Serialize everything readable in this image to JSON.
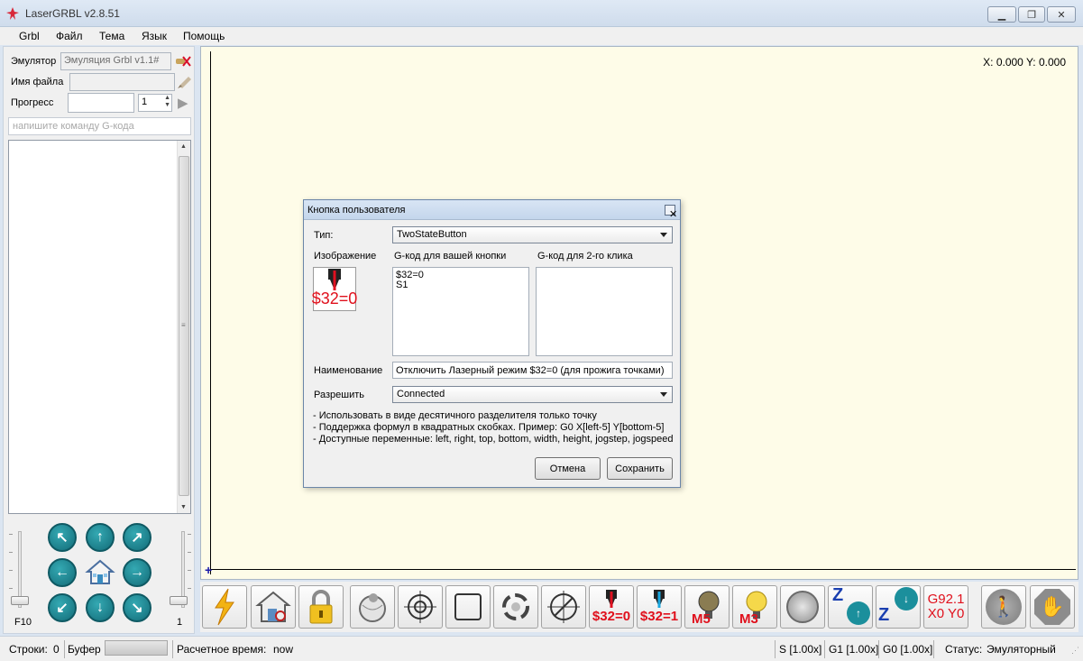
{
  "window": {
    "title": "LaserGRBL v2.8.51"
  },
  "menu": [
    "Grbl",
    "Файл",
    "Тема",
    "Язык",
    "Помощь"
  ],
  "left": {
    "emulator_label": "Эмулятор",
    "emulator_value": "Эмуляция Grbl v1.1#",
    "filename_label": "Имя файла",
    "progress_label": "Прогресс",
    "progress_count": "1",
    "command_placeholder": "напишите команду G-кода",
    "speed_label": "F10",
    "step_label": "1",
    "home_icon": "house-icon"
  },
  "canvas": {
    "coords": "X: 0.000 Y: 0.000"
  },
  "toolbar": {
    "buttons": [
      {
        "icon": "lightning-icon"
      },
      {
        "icon": "home-search-icon"
      },
      {
        "icon": "padlock-icon"
      },
      {
        "icon": "globe-pin-icon"
      },
      {
        "icon": "crosshair-icon"
      },
      {
        "icon": "frame-icon"
      },
      {
        "icon": "rotate-icon"
      },
      {
        "icon": "crosshair-arrows-icon"
      },
      {
        "icon": "laser-mode-off-icon",
        "text": "$32=0"
      },
      {
        "icon": "laser-mode-on-icon",
        "text": "$32=1"
      },
      {
        "icon": "bulb-off-icon",
        "text": "M5"
      },
      {
        "icon": "bulb-on-icon",
        "text": "M3"
      },
      {
        "icon": "diagonal-arrows-icon"
      },
      {
        "icon": "z-up-icon",
        "text": "Z"
      },
      {
        "icon": "z-down-icon",
        "text": "Z"
      },
      {
        "icon": "g92-icon",
        "text": "G92.1\nX0 Y0"
      },
      {
        "icon": "walk-icon"
      },
      {
        "icon": "stop-hand-icon"
      }
    ]
  },
  "status": {
    "lines_label": "Строки:",
    "lines_value": "0",
    "buffer_label": "Буфер",
    "est_label": "Расчетное время:",
    "est_value": "now",
    "s_override": "S [1.00x]",
    "g1_override": "G1 [1.00x]",
    "g0_override": "G0 [1.00x]",
    "state_label": "Статус:",
    "state_value": "Эмуляторный"
  },
  "dialog": {
    "title": "Кнопка пользователя",
    "type_label": "Тип:",
    "type_value": "TwoStateButton",
    "image_label": "Изображение",
    "image_text": "$32=0",
    "gcode_label": "G-код для вашей кнопки",
    "gcode_value": "$32=0\nS1",
    "gcode2_label": "G-код для 2-го клика",
    "gcode2_value": "",
    "name_label": "Наименование",
    "name_value": "Отключить Лазерный режим $32=0 (для прожига точками)",
    "enable_label": "Разрешить",
    "enable_value": "Connected",
    "notes": [
      "- Использовать в виде десятичного разделителя только точку",
      "- Поддержка формул в квадратных скобках. Пример: G0 X[left-5] Y[bottom-5]",
      "- Доступные переменные:  left, right, top, bottom, width, height, jogstep, jogspeed"
    ],
    "cancel_label": "Отмена",
    "save_label": "Сохранить"
  }
}
